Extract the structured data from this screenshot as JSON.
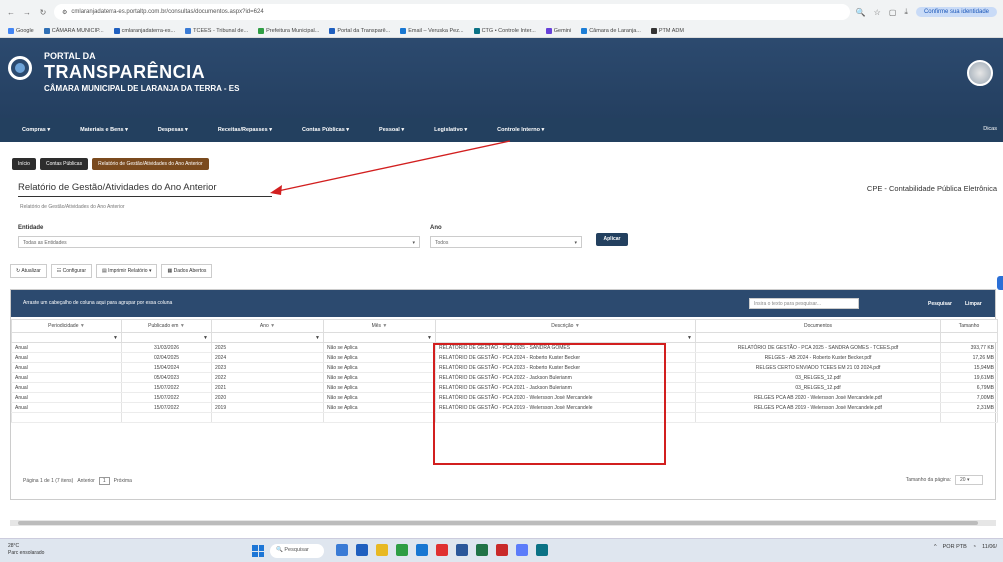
{
  "browser": {
    "url": "cmlaranjadaterra-es.portaltp.com.br/consultas/documentos.aspx?id=624",
    "profile_label": "Confirme sua identidade",
    "bookmarks": [
      "Google",
      "CÂMARA MUNICIP...",
      "cmlaranjadaterra-es...",
      "TCEES - Tribunal de...",
      "Prefeitura Municipal...",
      "Portal da Transparê...",
      "Email – Veruska Pez...",
      "CTG • Controle Inter...",
      "Gemini",
      "Câmara de Laranja...",
      "PTM ADM"
    ]
  },
  "portal": {
    "line1": "PORTAL DA",
    "line2": "TRANSPARÊNCIA",
    "line3": "CÂMARA MUNICIPAL DE LARANJA DA TERRA - ES"
  },
  "menu": {
    "items": [
      "Compras ▾",
      "Materiais e Bens ▾",
      "Despesas ▾",
      "Receitas/Repasses ▾",
      "Contas Públicas ▾",
      "Pessoal ▾",
      "Legislativo ▾",
      "Controle Interno ▾"
    ],
    "help": "Dicas"
  },
  "breadcrumb": [
    "Início",
    "Contas Públicas",
    "Relatório de Gestão/Atividades do Ano Anterior"
  ],
  "page": {
    "title": "Relatório de Gestão/Atividades do Ano Anterior",
    "subtitle": "Relatório de Gestão/Atividades do Ano Anterior",
    "cpe": "CPE - Contabilidade Pública Eletrônica"
  },
  "filters": {
    "entity_label": "Entidade",
    "entity_value": "Todas as Entidades",
    "year_label": "Ano",
    "year_value": "Todos",
    "apply": "Aplicar"
  },
  "toolbar": [
    "Atualizar",
    "Configurar",
    "Imprimir Relatório ▾",
    "Dados Abertos"
  ],
  "grid": {
    "group_text": "Arraste um cabeçalho de coluna aqui para agrupar por essa coluna",
    "search_placeholder": "Insira o texto para pesquisar...",
    "search_btn": "Pesquisar",
    "clear_btn": "Limpar",
    "columns": [
      "Periodicidade",
      "Publicado em",
      "Ano",
      "Mês",
      "Descrição",
      "Documentos",
      "Tamanho"
    ],
    "rows": [
      [
        "Anual",
        "31/03/2026",
        "2025",
        "Não se Aplica",
        "RELATÓRIO DE GESTÃO - PCA 2025 - SANDRA GOMES",
        "RELATÓRIO DE GESTÃO - PCA 2025 - SANDRA GOMES - TCEES.pdf",
        "393,77 KB"
      ],
      [
        "Anual",
        "02/04/2025",
        "2024",
        "Não se Aplica",
        "RELATÓRIO DE GESTÃO - PCA 2024 - Roberto Kuster Becker",
        "RELGES - AB 2024 - Roberto Kuster Becker.pdf",
        "17,26 MB"
      ],
      [
        "Anual",
        "15/04/2024",
        "2023",
        "Não se Aplica",
        "RELATÓRIO DE GESTÃO - PCA 2023 - Roberto Kuster Becker",
        "RELGES CERTO ENVIADO TCEES EM 21 03 2024.pdf",
        "15,94MB"
      ],
      [
        "Anual",
        "05/04/2023",
        "2022",
        "Não se Aplica",
        "RELATÓRIO DE GESTÃO - PCA 2022 - Jackson Bulerianm",
        "03_RELGES_12.pdf",
        "19,61MB"
      ],
      [
        "Anual",
        "15/07/2022",
        "2021",
        "Não se Aplica",
        "RELATÓRIO DE GESTÃO - PCA 2021 - Jackson Bulerianm",
        "03_RELGES_12.pdf",
        "6,79MB"
      ],
      [
        "Anual",
        "15/07/2022",
        "2020",
        "Não se Aplica",
        "RELATÓRIO DE GESTÃO - PCA 2020 - Welersson José Mercandele",
        "RELGES PCA AB 2020 - Welersson José Mercandele.pdf",
        "7,00MB"
      ],
      [
        "Anual",
        "15/07/2022",
        "2019",
        "Não se Aplica",
        "RELATÓRIO DE GESTÃO - PCA 2019 - Welersson José Mercandele",
        "RELGES PCA AB 2019 - Welersson José Mercandele.pdf",
        "2,31MB"
      ]
    ],
    "pager_text": "Página 1 de 1 (7 itens)",
    "prev": "Anterior",
    "page_num": "1",
    "next": "Próxima",
    "pagesize_label": "Tamanho da página:",
    "pagesize_value": "20"
  },
  "taskbar": {
    "temp": "28°C",
    "weather": "Parc ensolarado",
    "search": "Pesquisar",
    "lang": "POR PTB",
    "time": "11/06/"
  }
}
